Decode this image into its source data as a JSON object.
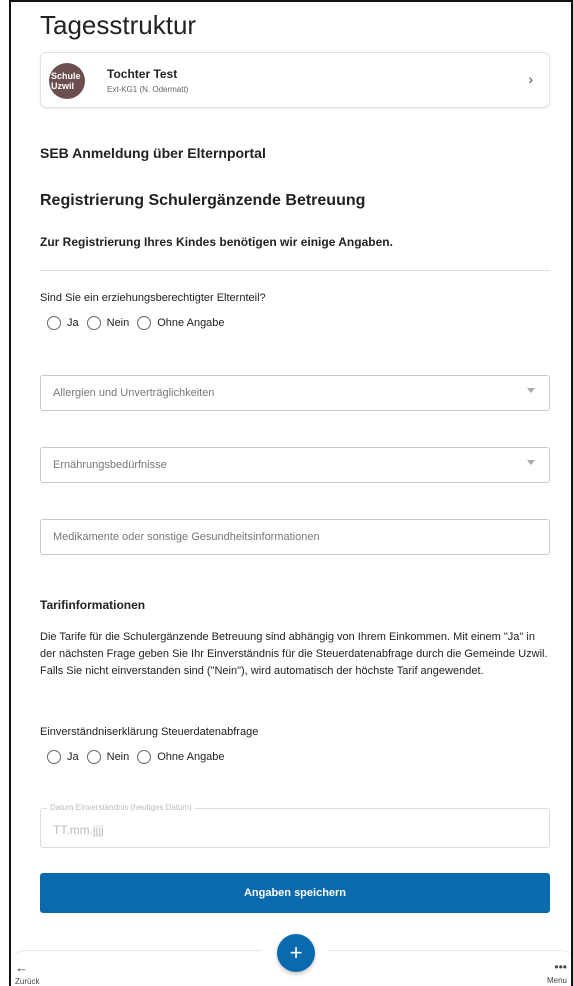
{
  "page": {
    "title": "Tagesstruktur"
  },
  "child": {
    "avatar_text": "Schule Uzwil",
    "name": "Tochter Test",
    "sub": "Ext-KG1 (N. Odermatt)"
  },
  "headings": {
    "seb": "SEB Anmeldung über Elternportal",
    "registration": "Registrierung Schulergänzende Betreuung",
    "intro": "Zur Registrierung Ihres Kindes benötigen wir einige Angaben."
  },
  "question_parent": {
    "label": "Sind Sie ein erziehungsberechtigter Elternteil?",
    "options": [
      "Ja",
      "Nein",
      "Ohne Angabe"
    ]
  },
  "fields": {
    "allergies": "Allergien und Unverträglichkeiten",
    "nutrition": "Ernährungsbedürfnisse",
    "medication": "Medikamente oder sonstige Gesundheitsinformationen"
  },
  "tarif": {
    "heading": "Tarifinformationen",
    "text": "Die Tarife für die Schulergänzende Betreuung sind abhängig von Ihrem Einkommen. Mit einem \"Ja\" in der nächsten Frage geben Sie Ihr Einverständnis für die Steuerdatenabfrage durch die Gemeinde Uzwil. Falls Sie nicht einverstanden sind (\"Nein\"), wird automatisch der höchste Tarif angewendet."
  },
  "question_consent": {
    "label": "Einverständniserklärung Steuerdatenabfrage",
    "options": [
      "Ja",
      "Nein",
      "Ohne Angabe"
    ]
  },
  "date_field": {
    "legend": "Datum Einverständnis (heutiges Datum)",
    "placeholder": "TT.mm.jjjj"
  },
  "save_label": "Angaben speichern",
  "bottom_nav": {
    "back_label": "Zurück",
    "menu_label": "Menu",
    "fab_label": "+"
  },
  "colors": {
    "accent": "#0a6aad"
  }
}
